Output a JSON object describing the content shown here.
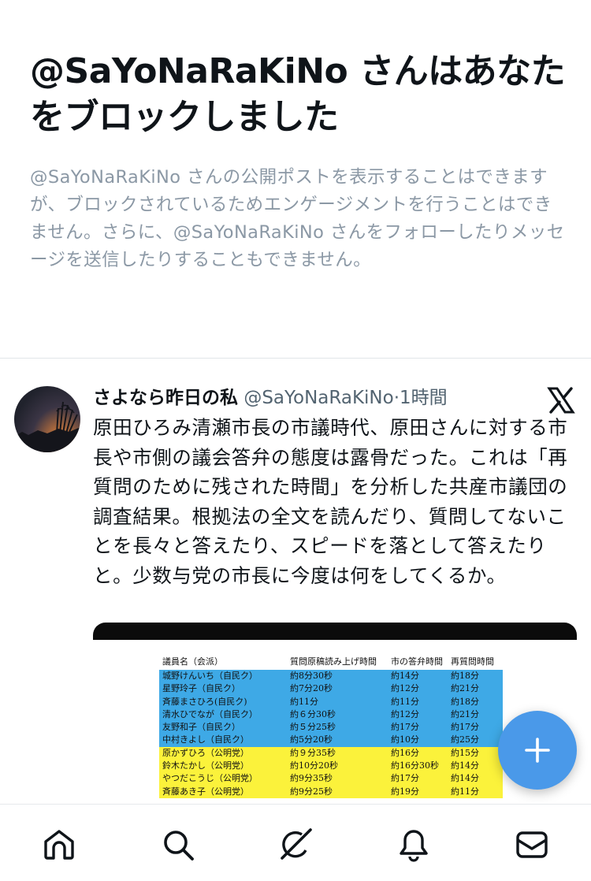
{
  "blocked": {
    "title": "@SaYoNaRaKiNo さんはあなたをブロックしました",
    "description": "@SaYoNaRaKiNo さんの公開ポストを表示することはできますが、ブロックされているためエンゲージメントを行うことはできません。さらに、@SaYoNaRaKiNo さんをフォローしたりメッセージを送信したりすることもできません。"
  },
  "tweet": {
    "author_name": "さよなら昨日の私",
    "handle": "@SaYoNaRaKiNo",
    "separator": "·",
    "time": "1時間",
    "text": "原田ひろみ清瀬市長の市議時代、原田さんに対する市長や市側の議会答弁の態度は露骨だった。これは「再質問のために残された時間」を分析した共産市議団の調査結果。根拠法の全文を読んだり、質問してないことを長々と答えたり、スピードを落として答えたりと。少数与党の市長に今度は何をしてくるか。"
  },
  "media_table": {
    "headers": [
      "議員名（会派）",
      "質問原稿読み上げ時間",
      "市の答弁時間",
      "再質問時間"
    ],
    "rows": [
      {
        "name": "城野けんいち（自民ク）",
        "read": "約8分30秒",
        "answer": "約14分",
        "requestion": "約18分",
        "group": "ldp"
      },
      {
        "name": "星野玲子（自民ク）",
        "read": "約7分20秒",
        "answer": "約12分",
        "requestion": "約21分",
        "group": "ldp"
      },
      {
        "name": "斉藤まさひろ(自民ク)",
        "read": "約11分",
        "answer": "約11分",
        "requestion": "約18分",
        "group": "ldp"
      },
      {
        "name": "清水ひでなが（自民ク）",
        "read": "約６分30秒",
        "answer": "約12分",
        "requestion": "約21分",
        "group": "ldp"
      },
      {
        "name": "友野和子（自民ク）",
        "read": "約５分25秒",
        "answer": "約17分",
        "requestion": "約17分",
        "group": "ldp"
      },
      {
        "name": "中村きよし（自民ク）",
        "read": "約5分20秒",
        "answer": "約10分",
        "requestion": "約25分",
        "group": "ldp"
      },
      {
        "name": "原かずひろ（公明党）",
        "read": "約９分35秒",
        "answer": "約16分",
        "requestion": "約15分",
        "group": "komei"
      },
      {
        "name": "鈴木たかし（公明党）",
        "read": "約10分20秒",
        "answer": "約16分30秒",
        "requestion": "約14分",
        "group": "komei"
      },
      {
        "name": "やつだこうじ（公明党）",
        "read": "約9分35秒",
        "answer": "約17分",
        "requestion": "約14分",
        "group": "komei"
      },
      {
        "name": "斉藤あき子（公明党）",
        "read": "約9分25秒",
        "answer": "約19分",
        "requestion": "約11分",
        "group": "komei"
      }
    ]
  },
  "fab": {
    "icon": "plus-icon",
    "color": "#4a99e9"
  },
  "bottom_nav": [
    {
      "name": "home",
      "icon": "home-icon"
    },
    {
      "name": "search",
      "icon": "search-icon"
    },
    {
      "name": "grok",
      "icon": "grok-icon"
    },
    {
      "name": "notifications",
      "icon": "bell-icon"
    },
    {
      "name": "messages",
      "icon": "mail-icon"
    }
  ],
  "colors": {
    "accent": "#4a99e9",
    "text_primary": "#0f1419",
    "text_secondary": "#536471",
    "ldp_row": "#3ea9e6",
    "komei_row": "#fbf23b"
  }
}
